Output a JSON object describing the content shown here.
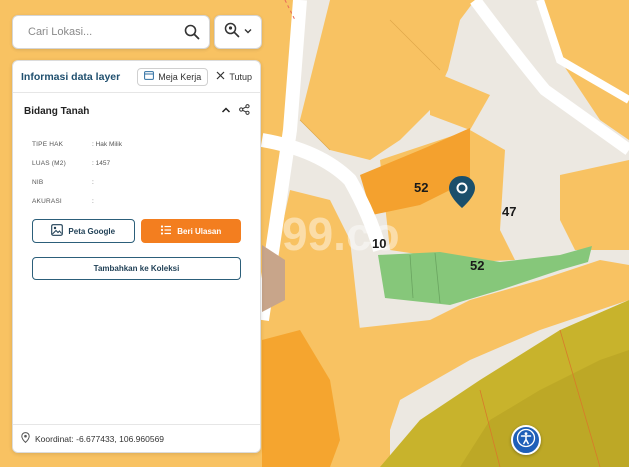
{
  "search": {
    "placeholder": "Cari Lokasi..."
  },
  "panel": {
    "title": "Informasi data layer",
    "workspace_label": "Meja Kerja",
    "close_label": "Tutup",
    "section_title": "Bidang Tanah",
    "attributes": [
      {
        "key": "TIPE HAK",
        "value": ": Hak Milik"
      },
      {
        "key": "LUAS (M2)",
        "value": ": 1457"
      },
      {
        "key": "NIB",
        "value": ":"
      },
      {
        "key": "AKURASI",
        "value": ":"
      }
    ],
    "google_button": "Peta Google",
    "review_button": "Beri Ulasan",
    "collection_button": "Tambahkan ke Koleksi",
    "coordinates": "Koordinat: -6.677433, 106.960569"
  },
  "map": {
    "parcel_labels": [
      {
        "text": "52"
      },
      {
        "text": "47"
      },
      {
        "text": "52"
      },
      {
        "text": "10"
      }
    ],
    "watermark": "99.co"
  },
  "colors": {
    "accent_orange": "#f37e1f",
    "brand_teal": "#1f4f6e",
    "marker": "#1b4f6b",
    "accessibility": "#1f5fb8"
  },
  "icons": {
    "search": "search-icon",
    "zoom": "zoom-location-icon",
    "chevron": "chevron-down-icon",
    "workspace": "window-icon",
    "close": "close-icon",
    "collapse": "chevron-up-icon",
    "share": "share-icon",
    "google": "image-icon",
    "review": "list-icon",
    "location": "location-pin-icon",
    "accessibility": "accessibility-icon"
  }
}
